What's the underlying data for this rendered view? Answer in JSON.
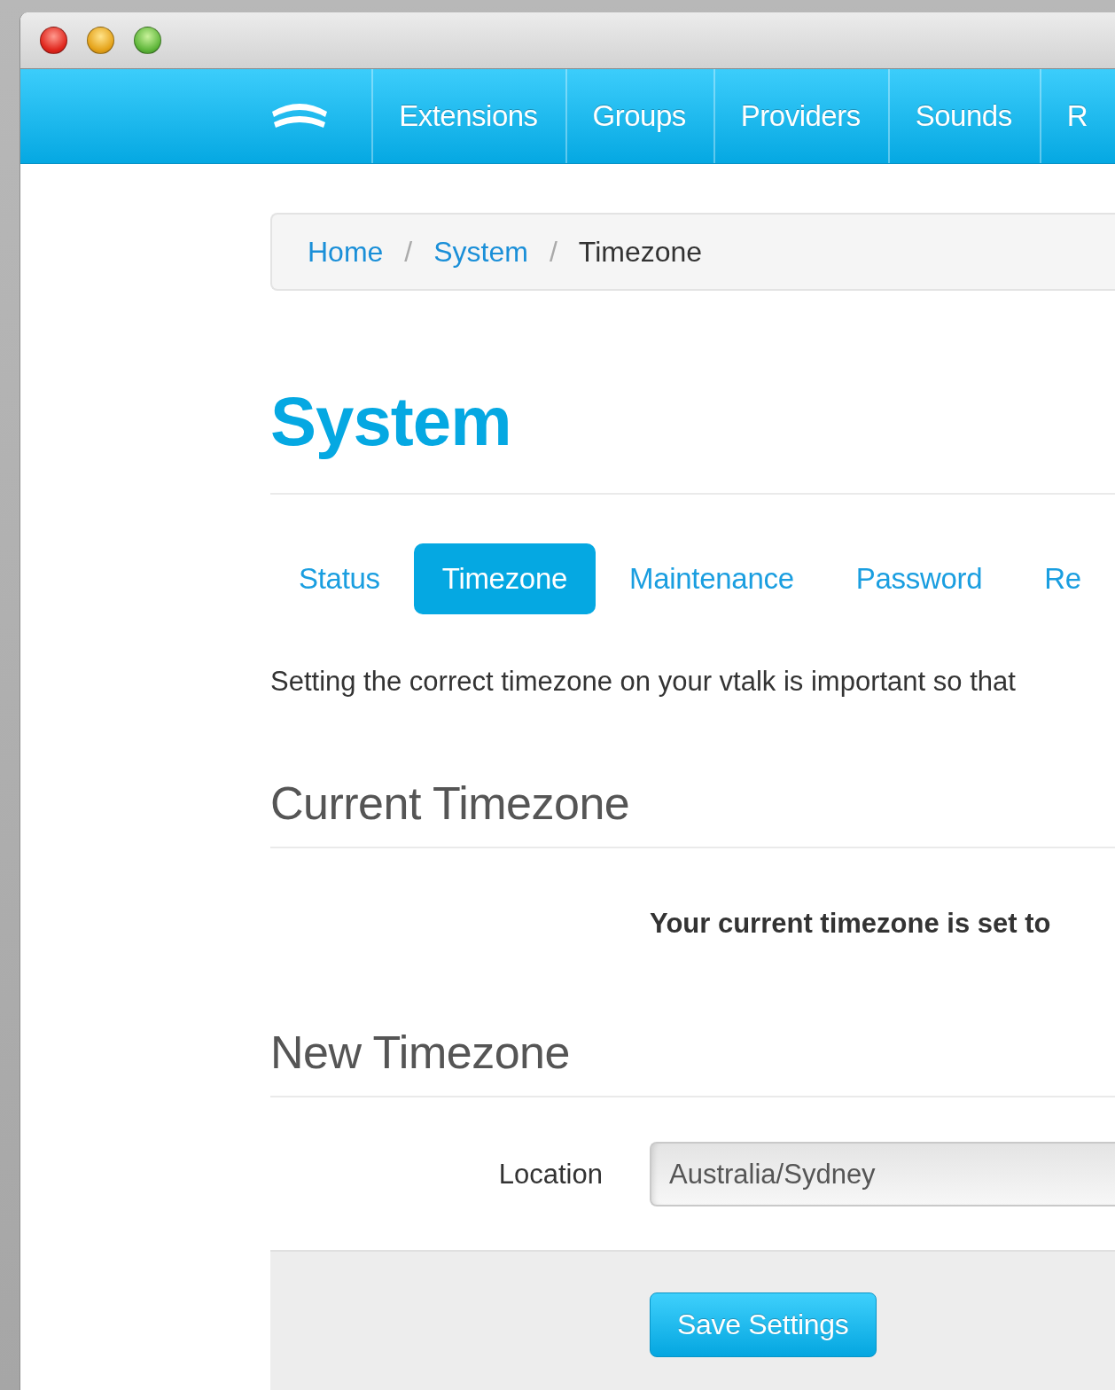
{
  "navbar": {
    "items": [
      {
        "label": "Extensions"
      },
      {
        "label": "Groups"
      },
      {
        "label": "Providers"
      },
      {
        "label": "Sounds"
      },
      {
        "label": "R"
      }
    ]
  },
  "breadcrumb": [
    {
      "label": "Home",
      "kind": "link"
    },
    {
      "label": "/",
      "kind": "separator"
    },
    {
      "label": "System",
      "kind": "link"
    },
    {
      "label": "/",
      "kind": "separator"
    },
    {
      "label": "Timezone",
      "kind": "current"
    }
  ],
  "page_title": "System",
  "tabs": [
    {
      "label": "Status",
      "selected": false
    },
    {
      "label": "Timezone",
      "selected": true
    },
    {
      "label": "Maintenance",
      "selected": false
    },
    {
      "label": "Password",
      "selected": false
    },
    {
      "label": "Re",
      "selected": false
    }
  ],
  "intro": "Setting the correct timezone on your vtalk is important so that",
  "current_timezone": {
    "heading": "Current Timezone",
    "message": "Your current timezone is set to"
  },
  "new_timezone": {
    "heading": "New Timezone",
    "fields": [
      {
        "label": "Location",
        "value": "Australia/Sydney"
      }
    ]
  },
  "save_button": "Save Settings"
}
